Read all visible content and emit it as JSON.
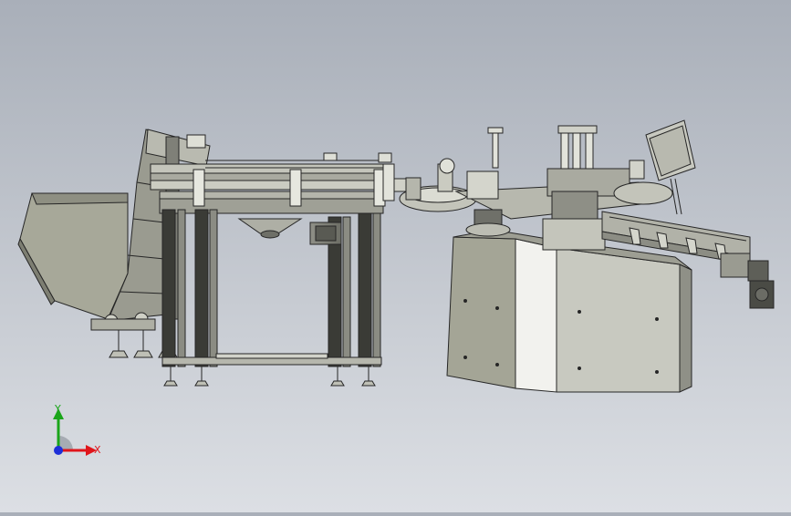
{
  "viewport": {
    "background_top": "#a9afb9",
    "background_bottom": "#dcdfe4",
    "model_fill": "#c7c9bf",
    "model_edge": "#262626"
  },
  "triad": {
    "x_label": "X",
    "y_label": "Y",
    "x_color": "#e0151b",
    "y_color": "#1aa51a",
    "z_color": "#1d2fd8"
  }
}
